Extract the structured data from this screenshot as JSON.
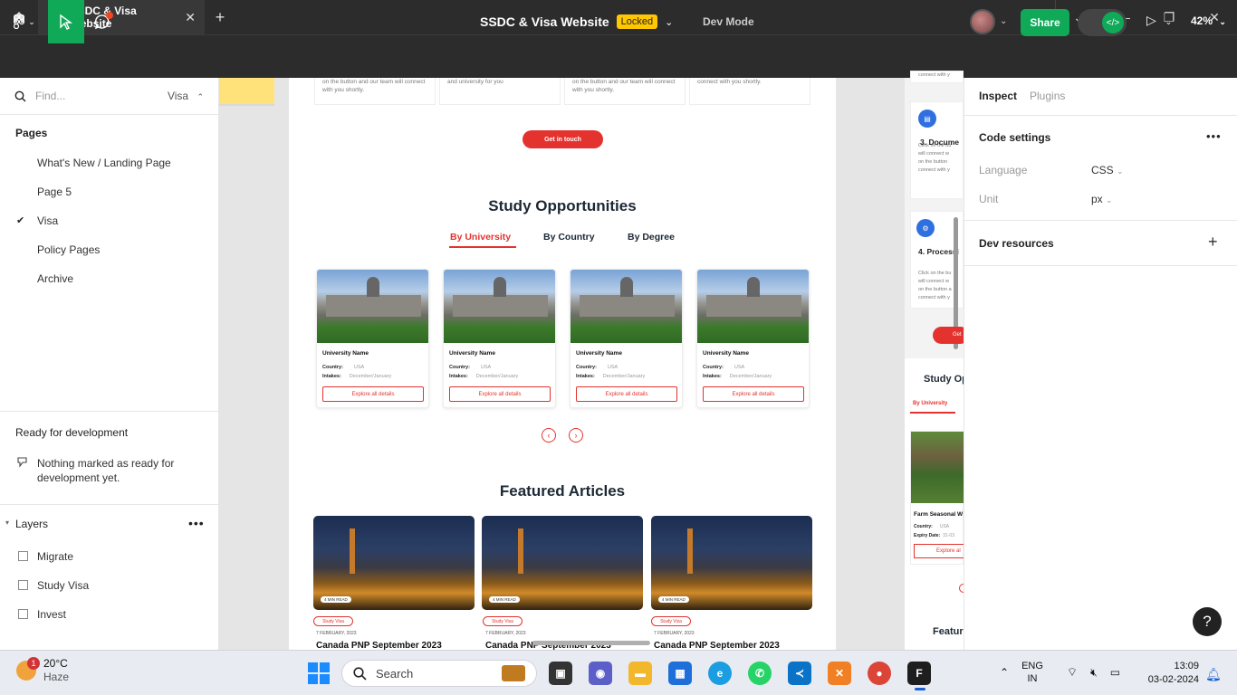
{
  "titlebar": {
    "tab_title": "SSDC & Visa Website",
    "tab_icon": "code-icon",
    "close_glyph": "✕",
    "newtab_glyph": "+"
  },
  "toolbar": {
    "file_title": "SSDC & Visa Website",
    "locked_label": "Locked",
    "devmode_label": "Dev Mode",
    "share_label": "Share",
    "zoom_label": "42%"
  },
  "leftpanel": {
    "find_placeholder": "Find...",
    "page_selector": "Visa",
    "pages_title": "Pages",
    "pages": [
      {
        "label": "What's New / Landing Page",
        "selected": false
      },
      {
        "label": "Page 5",
        "selected": false
      },
      {
        "label": "Visa",
        "selected": true
      },
      {
        "label": "Policy Pages",
        "selected": false
      },
      {
        "label": "Archive",
        "selected": false
      }
    ],
    "ready_title": "Ready for development",
    "ready_message": "Nothing marked as ready for development yet.",
    "layers_title": "Layers",
    "layers": [
      {
        "label": "Migrate"
      },
      {
        "label": "Study Visa"
      },
      {
        "label": "Invest"
      }
    ]
  },
  "canvas": {
    "top_cards": [
      {
        "text": "on the button and our team will connect with you shortly."
      },
      {
        "text": "and university for you"
      },
      {
        "text": "on the button and our team will connect with you shortly."
      },
      {
        "text": "connect with you shortly."
      }
    ],
    "get_in_touch": "Get in touch",
    "study_heading": "Study Opportunities",
    "tabs": [
      "By University",
      "By Country",
      "By Degree"
    ],
    "university_cards": [
      {
        "name": "University Name",
        "country_label": "Country:",
        "country": "USA",
        "intakes_label": "Intakes:",
        "intakes": "December/January",
        "button": "Explore all details"
      },
      {
        "name": "University Name",
        "country_label": "Country:",
        "country": "USA",
        "intakes_label": "Intakes:",
        "intakes": "December/January",
        "button": "Explore all details"
      },
      {
        "name": "University Name",
        "country_label": "Country:",
        "country": "USA",
        "intakes_label": "Intakes:",
        "intakes": "December/January",
        "button": "Explore all details"
      },
      {
        "name": "University Name",
        "country_label": "Country:",
        "country": "USA",
        "intakes_label": "Intakes:",
        "intakes": "December/January",
        "button": "Explore all details"
      }
    ],
    "featured_heading": "Featured Articles",
    "articles": [
      {
        "read": "4 MIN READ",
        "tag": "Study Visa",
        "date": "7 FEBRUARY, 2023",
        "title": "Canada PNP September 2023"
      },
      {
        "read": "4 MIN READ",
        "tag": "Study Visa",
        "date": "7 FEBRUARY, 2023",
        "title": "Canada PNP September 2023"
      },
      {
        "read": "4 MIN READ",
        "tag": "Study Visa",
        "date": "7 FEBRUARY, 2023",
        "title": "Canada PNP September 2023"
      }
    ]
  },
  "mobile_frame": {
    "card_top_text": "connect with y",
    "step3_title": "3. Docume",
    "step3_text": [
      "Click on the bu",
      "will connect w",
      "on the button",
      "connect with y"
    ],
    "step4_title": "4. Processi",
    "step4_text": [
      "Click on the bu",
      "will connect w",
      "on the button a",
      "connect with y"
    ],
    "button": "Get",
    "study_heading": "Study Op",
    "tab": "By University",
    "card_title": "Farm Seasonal W",
    "country_label": "Country:",
    "country": "USA",
    "expiry_label": "Expiry Date:",
    "expiry": "31-03",
    "explore": "Explore al",
    "featured": "Featur"
  },
  "rightpanel": {
    "tabs": [
      "Inspect",
      "Plugins"
    ],
    "code_settings": "Code settings",
    "language_label": "Language",
    "language_value": "CSS",
    "unit_label": "Unit",
    "unit_value": "px",
    "dev_resources": "Dev resources",
    "help": "?"
  },
  "taskbar": {
    "temperature": "20°C",
    "weather": "Haze",
    "weather_badge": "1",
    "search_label": "Search",
    "lang_line1": "ENG",
    "lang_line2": "IN",
    "time": "13:09",
    "date": "03-02-2024"
  },
  "colors": {
    "figma_green": "#0fa958",
    "locked_yellow": "#ffc700",
    "brand_red": "#e4332e",
    "dark_chrome": "#2c2c2c"
  }
}
